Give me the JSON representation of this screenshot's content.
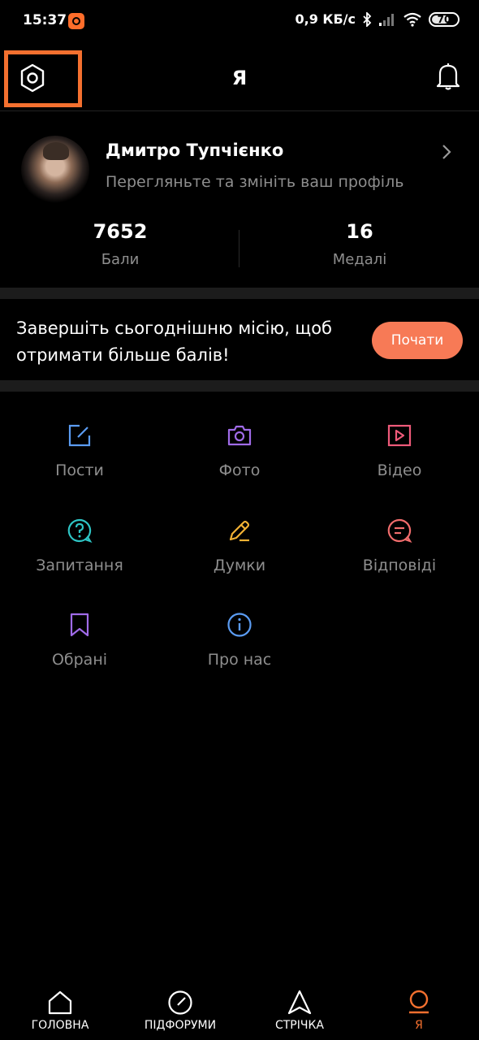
{
  "status_bar": {
    "time": "15:37",
    "speed": "0,9 КБ/с",
    "battery": "70",
    "battery_level": 70
  },
  "header": {
    "title": "Я",
    "settings_icon": "settings-hexagon-icon",
    "bell_icon": "bell-icon",
    "highlight_color": "#f4702f"
  },
  "profile": {
    "name": "Дмитро Тупчієнко",
    "subtitle": "Перегляньте та змініть ваш профіль",
    "stats": [
      {
        "value": "7652",
        "label": "Бали"
      },
      {
        "value": "16",
        "label": "Медалі"
      }
    ]
  },
  "mission": {
    "text": "Завершіть сьогоднішню місію, щоб отримати більше балів!",
    "button_label": "Почати",
    "button_color": "#f77a56"
  },
  "menu": {
    "items": [
      {
        "label": "Пости",
        "icon": "edit-square-icon",
        "color": "#5b9cf2"
      },
      {
        "label": "Фото",
        "icon": "camera-icon",
        "color": "#a06be8"
      },
      {
        "label": "Відео",
        "icon": "video-play-icon",
        "color": "#ef5a7a"
      },
      {
        "label": "Запитання",
        "icon": "question-bubble-icon",
        "color": "#2ec6c6"
      },
      {
        "label": "Думки",
        "icon": "pencil-icon",
        "color": "#f2b234"
      },
      {
        "label": "Відповіді",
        "icon": "chat-bubble-icon",
        "color": "#f26d6d"
      },
      {
        "label": "Обрані",
        "icon": "bookmark-icon",
        "color": "#a06be8"
      },
      {
        "label": "Про нас",
        "icon": "info-icon",
        "color": "#5b9cf2"
      }
    ]
  },
  "bottom_nav": {
    "items": [
      {
        "label": "ГОЛОВНА",
        "icon": "home-icon"
      },
      {
        "label": "ПІДФОРУМИ",
        "icon": "compass-icon"
      },
      {
        "label": "СТРІЧКА",
        "icon": "navigation-arrow-icon"
      },
      {
        "label": "Я",
        "icon": "profile-icon"
      }
    ],
    "active_index": 3,
    "active_color": "#f4702f"
  }
}
